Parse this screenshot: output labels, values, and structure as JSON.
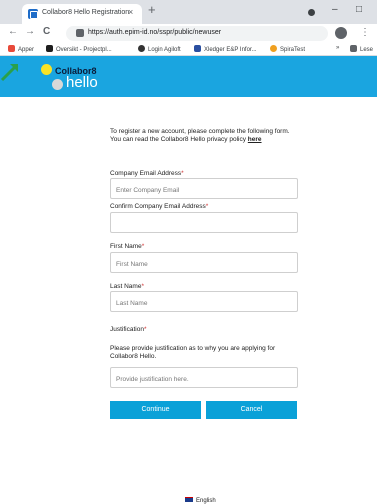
{
  "browser": {
    "tab_title": "Collabor8 Hello Registration",
    "tab_close": "×",
    "new_tab": "+",
    "url": "https://auth.epim-id.no/sspr/public/newuser",
    "back": "←",
    "forward": "→",
    "reload": "C",
    "minimize": "–",
    "maximize": "□",
    "more": "⋮",
    "bookmarks": [
      {
        "label": "Apper",
        "color": "#e84a3a"
      },
      {
        "label": "Oversikt - Projectpl...",
        "color": "#1e1e1e"
      },
      {
        "label": "Login Agiloft",
        "color": "#333333"
      },
      {
        "label": "Xledger E&P Infor...",
        "color": "#2a4fa0"
      },
      {
        "label": "SpiraTest",
        "color": "#f0a020"
      }
    ],
    "bookmarks_overflow": "»",
    "reading_list": "Lese"
  },
  "header": {
    "logo_line1": "Collabor8",
    "logo_line2": "hello"
  },
  "form": {
    "intro_line1": "To register a new account, please complete the following form.",
    "intro_line2": "You can read the Collabor8 Hello privacy policy",
    "privacy_link": "here",
    "company_email_label": "Company Email Address",
    "company_email_placeholder": "Enter Company Email",
    "confirm_email_label": "Confirm Company Email Address",
    "confirm_email_value": "",
    "first_name_label": "First Name",
    "first_name_placeholder": "First Name",
    "last_name_label": "Last Name",
    "last_name_placeholder": "Last Name",
    "justification_label": "Justification",
    "justification_helper": "Please provide justification as to why you are applying for Collabor8 Hello.",
    "justification_placeholder": "Provide justification here.",
    "required_mark": "*",
    "continue_label": "Continue",
    "cancel_label": "Cancel"
  },
  "footer": {
    "language": "English"
  },
  "colors": {
    "banner": "#1aa5e0",
    "button": "#0aa1d8",
    "arrow": "#2aa04a"
  }
}
